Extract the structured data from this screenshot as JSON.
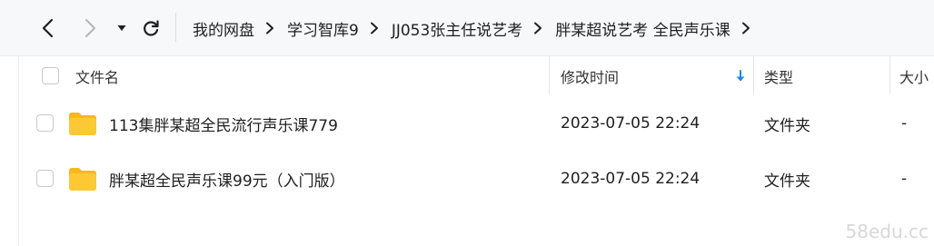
{
  "nav": {
    "icons": [
      "back-arrow-icon",
      "forward-arrow-icon",
      "dropdown-triangle-icon",
      "refresh-icon"
    ],
    "breadcrumbs": [
      {
        "label": "我的网盘"
      },
      {
        "label": "学习智库9"
      },
      {
        "label": "JJ053张主任说艺考"
      },
      {
        "label": "胖某超说艺考 全民声乐课"
      }
    ]
  },
  "table": {
    "columns": {
      "name": "文件名",
      "modified": "修改时间",
      "type": "类型",
      "size": "大小"
    },
    "sort": {
      "column": "modified",
      "direction": "descending",
      "icon": "sort-down-arrow-icon",
      "color": "#1e88e5"
    },
    "rows": [
      {
        "name": "113集胖某超全民流行声乐课779",
        "modified": "2023-07-05 22:24",
        "type": "文件夹",
        "size": "-",
        "icon": "folder-icon"
      },
      {
        "name": "胖某超全民声乐课99元（入门版）",
        "modified": "2023-07-05 22:24",
        "type": "文件夹",
        "size": "-",
        "icon": "folder-icon"
      }
    ]
  },
  "watermark": "58edu.cc",
  "colors": {
    "folder": "#fcc934",
    "folder_tab": "#f6b81b",
    "accent": "#1e88e5"
  }
}
